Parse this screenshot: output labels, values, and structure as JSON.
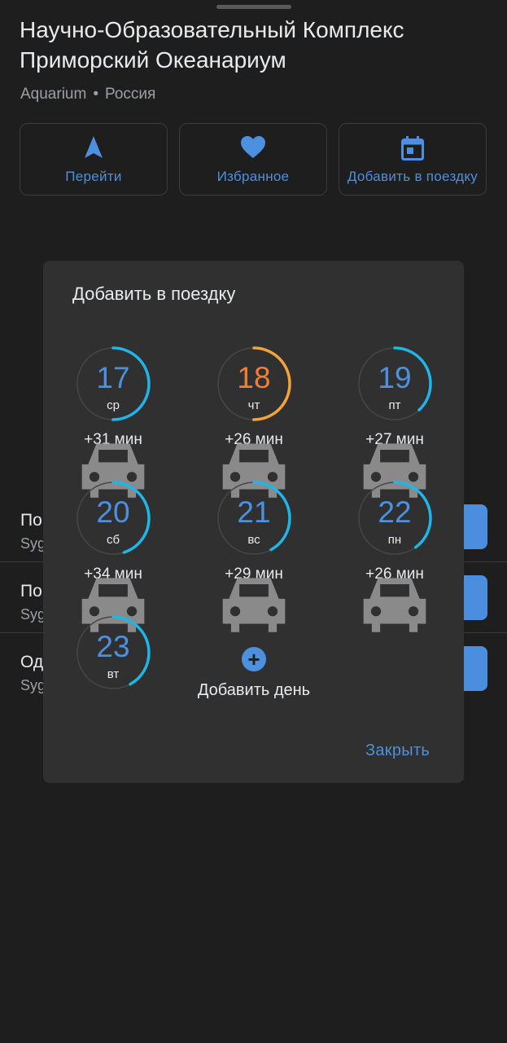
{
  "place": {
    "title": "Научно-Образовательный Комплекс Приморский Океанариум",
    "category": "Aquarium",
    "separator": "•",
    "country": "Россия"
  },
  "actions": [
    {
      "label": "Перейти",
      "icon": "navigation-arrow-icon"
    },
    {
      "label": "Избранное",
      "icon": "heart-icon"
    },
    {
      "label": "Добавить в поездку",
      "icon": "calendar-icon"
    }
  ],
  "background_rows": [
    {
      "title": "По",
      "subtitle": "Syg"
    },
    {
      "title": "По",
      "subtitle": "Syg"
    },
    {
      "title": "Од",
      "subtitle": "Syg"
    }
  ],
  "dialog": {
    "title": "Добавить в поездку",
    "days": [
      {
        "day": "17",
        "weekday": "ср",
        "travel": "+31 мин",
        "progress": 0.5,
        "color": "#1fb5e8",
        "highlight": false
      },
      {
        "day": "18",
        "weekday": "чт",
        "travel": "+26 мин",
        "progress": 0.5,
        "color": "#f2a43a",
        "highlight": true
      },
      {
        "day": "19",
        "weekday": "пт",
        "travel": "+27 мин",
        "progress": 0.38,
        "color": "#1fb5e8",
        "highlight": false
      },
      {
        "day": "20",
        "weekday": "сб",
        "travel": "+34 мин",
        "progress": 0.45,
        "color": "#1fb5e8",
        "highlight": false
      },
      {
        "day": "21",
        "weekday": "вс",
        "travel": "+29 мин",
        "progress": 0.42,
        "color": "#1fb5e8",
        "highlight": false
      },
      {
        "day": "22",
        "weekday": "пн",
        "travel": "+26 мин",
        "progress": 0.4,
        "color": "#1fb5e8",
        "highlight": false
      },
      {
        "day": "23",
        "weekday": "вт",
        "travel": "",
        "progress": 0.42,
        "color": "#1fb5e8",
        "highlight": false
      }
    ],
    "add_day_label": "Добавить день",
    "close_label": "Закрыть"
  },
  "colors": {
    "accent": "#4d90e0",
    "highlight": "#f07f35",
    "dialog_bg": "#303030",
    "page_bg": "#1e1e1e"
  }
}
